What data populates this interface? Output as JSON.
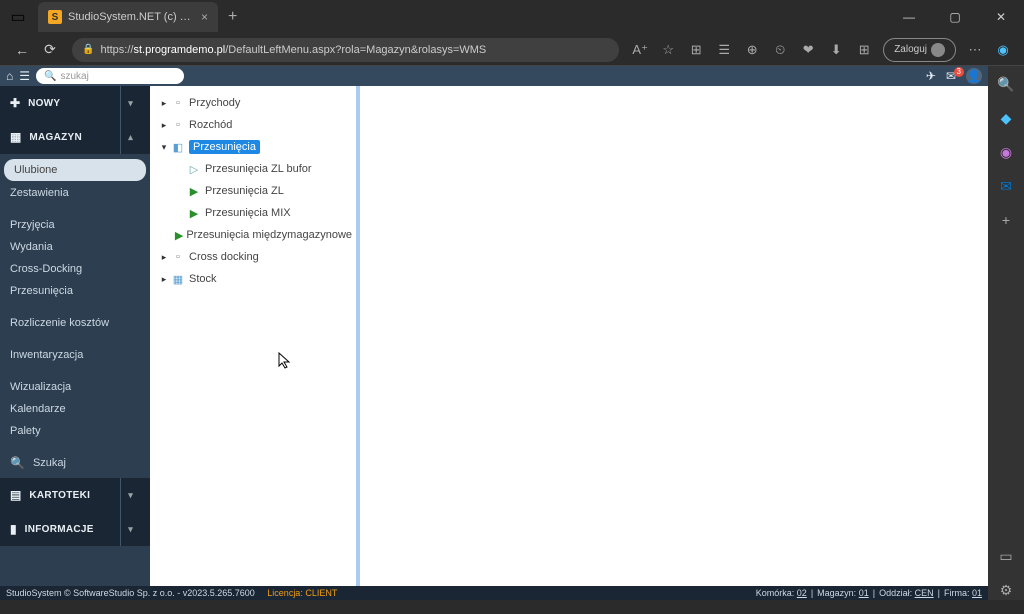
{
  "browser": {
    "tab_title": "StudioSystem.NET (c) SoftwareSt",
    "url_domain": "st.programdemo.pl",
    "url_path": "/DefaultLeftMenu.aspx?rola=Magazyn&rolasys=WMS",
    "login_label": "Zaloguj"
  },
  "app": {
    "search_placeholder": "szukaj",
    "mail_count": "3"
  },
  "sidebar": {
    "nowy": "NOWY",
    "magazyn": "MAGAZYN",
    "items1": [
      "Ulubione",
      "Zestawienia"
    ],
    "items2": [
      "Przyjęcia",
      "Wydania",
      "Cross-Docking",
      "Przesunięcia"
    ],
    "items3": [
      "Rozliczenie kosztów"
    ],
    "items4": [
      "Inwentaryzacja"
    ],
    "items5": [
      "Wizualizacja",
      "Kalendarze",
      "Palety"
    ],
    "szukaj": "Szukaj",
    "kartoteki": "KARTOTEKI",
    "informacje": "INFORMACJE"
  },
  "tree": {
    "przychody": "Przychody",
    "rozchod": "Rozchód",
    "przesuniecia": "Przesunięcia",
    "sub": {
      "zl_bufor": "Przesunięcia ZL bufor",
      "zl": "Przesunięcia ZL",
      "mix": "Przesunięcia MIX",
      "miedzy": "Przesunięcia międzymagazynowe"
    },
    "cross": "Cross docking",
    "stock": "Stock"
  },
  "status": {
    "left": "StudioSystem © SoftwareStudio Sp. z o.o. - v2023.5.265.7600",
    "license": "Licencja: CLIENT",
    "komorka_l": "Komórka:",
    "komorka_v": "02",
    "magazyn_l": "Magazyn:",
    "magazyn_v": "01",
    "oddzial_l": "Oddział:",
    "oddzial_v": "CEN",
    "firma_l": "Firma:",
    "firma_v": "01"
  }
}
